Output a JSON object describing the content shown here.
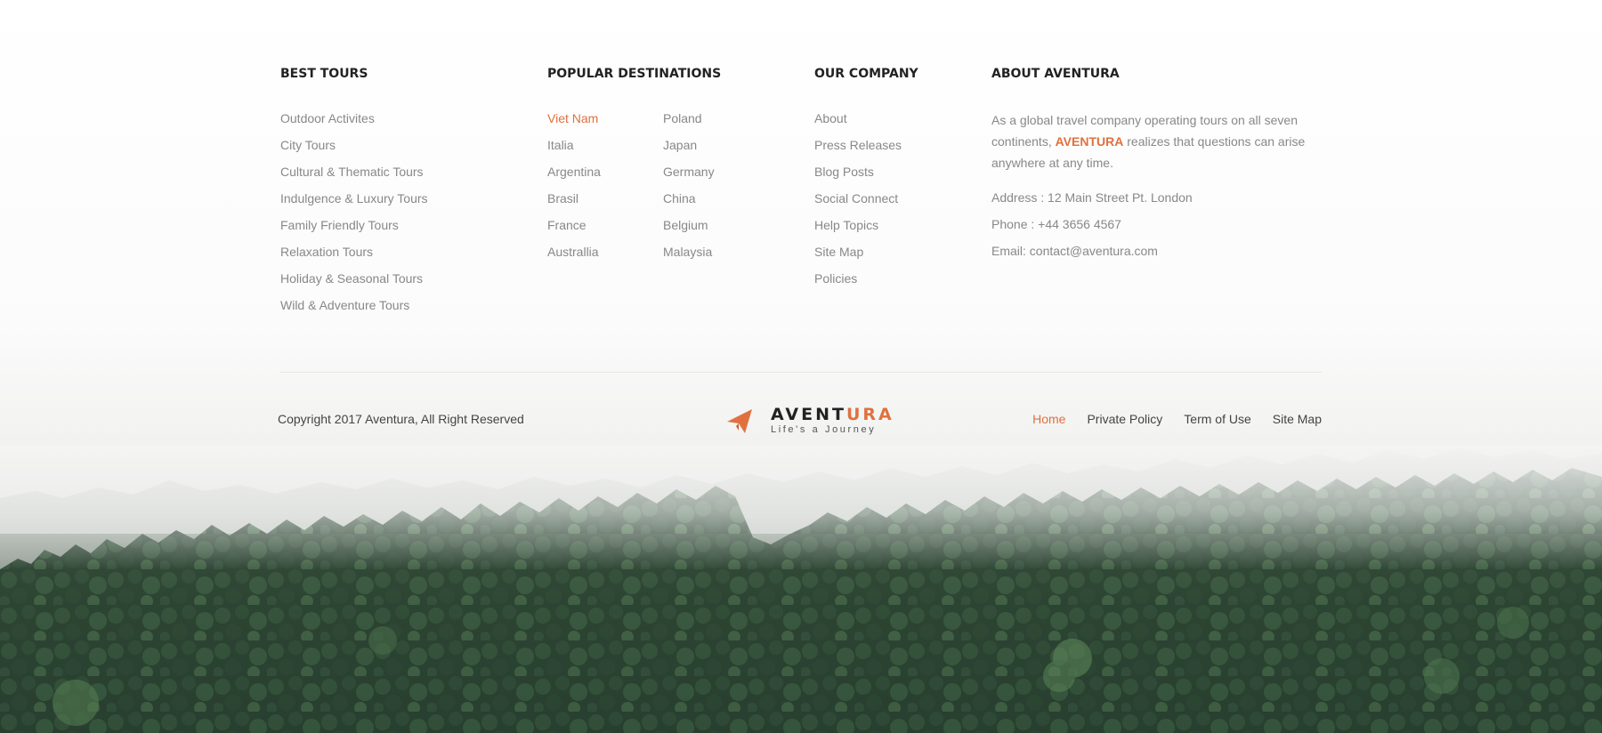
{
  "columns": {
    "best_tours": {
      "title": "BEST TOURS",
      "items": [
        "Outdoor Activites",
        "City Tours",
        "Cultural & Thematic Tours",
        "Indulgence & Luxury Tours",
        "Family Friendly Tours",
        "Relaxation Tours",
        "Holiday & Seasonal Tours",
        "Wild & Adventure Tours"
      ]
    },
    "popular_destinations": {
      "title": "POPULAR DESTINATIONS",
      "left": [
        "Viet Nam",
        "Italia",
        "Argentina",
        "Brasil",
        "France",
        "Australlia"
      ],
      "right": [
        "Poland",
        "Japan",
        "Germany",
        "China",
        "Belgium",
        "Malaysia"
      ],
      "active_item": "Viet Nam"
    },
    "our_company": {
      "title": "OUR COMPANY",
      "items": [
        "About",
        "Press Releases",
        "Blog Posts",
        "Social Connect",
        "Help Topics",
        "Site Map",
        "Policies"
      ]
    },
    "about": {
      "title": "ABOUT AVENTURA",
      "text_before": "As a global travel company operating tours on all seven continents, ",
      "brand": "AVENTURA",
      "text_after": " realizes that questions can arise anywhere at any time.",
      "address": "Address : 12 Main Street Pt. London",
      "phone": "Phone : +44 3656 4567",
      "email": "Email: contact@aventura.com"
    }
  },
  "bottom": {
    "copyright": "Copyright 2017 Aventura, All Right Reserved",
    "logo": {
      "name_part1": "AVENT",
      "name_part2": "URA",
      "tagline": "Life's a Journey",
      "icon": "paper-plane-icon"
    },
    "nav": [
      "Home",
      "Private Policy",
      "Term of Use",
      "Site Map"
    ],
    "active_nav": "Home"
  },
  "colors": {
    "accent": "#e0713e",
    "heading": "#222222",
    "link": "#888888",
    "forest_dark": "#263d2c",
    "fog": "#f3f3f3"
  }
}
